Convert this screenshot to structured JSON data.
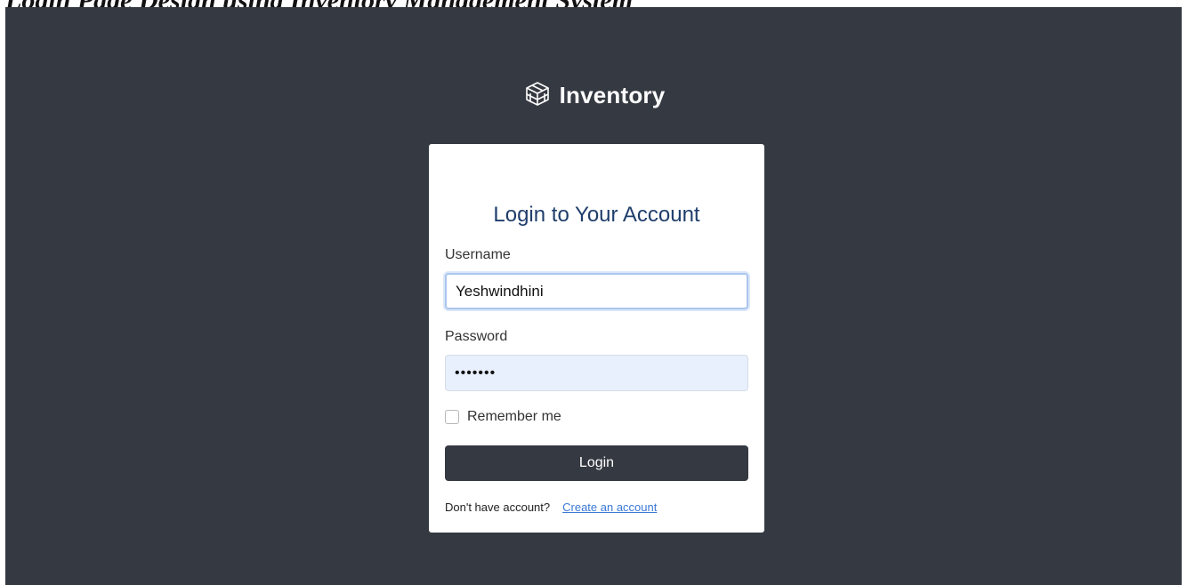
{
  "caption": "Login Page Design using Inventory Management System",
  "brand": {
    "name": "Inventory",
    "icon": "boxes-icon"
  },
  "login_card": {
    "title": "Login to Your Account",
    "username_label": "Username",
    "username_value": "Yeshwindhini",
    "password_label": "Password",
    "password_value": "•••••••",
    "remember_label": "Remember me",
    "remember_checked": false,
    "submit_label": "Login",
    "signup_prompt": "Don't have account?",
    "signup_link": "Create an account"
  },
  "colors": {
    "background": "#353941",
    "card": "#ffffff",
    "title": "#1f3e6b",
    "button": "#353941",
    "link": "#3a78d6",
    "autofill": "#e8f0fe"
  }
}
